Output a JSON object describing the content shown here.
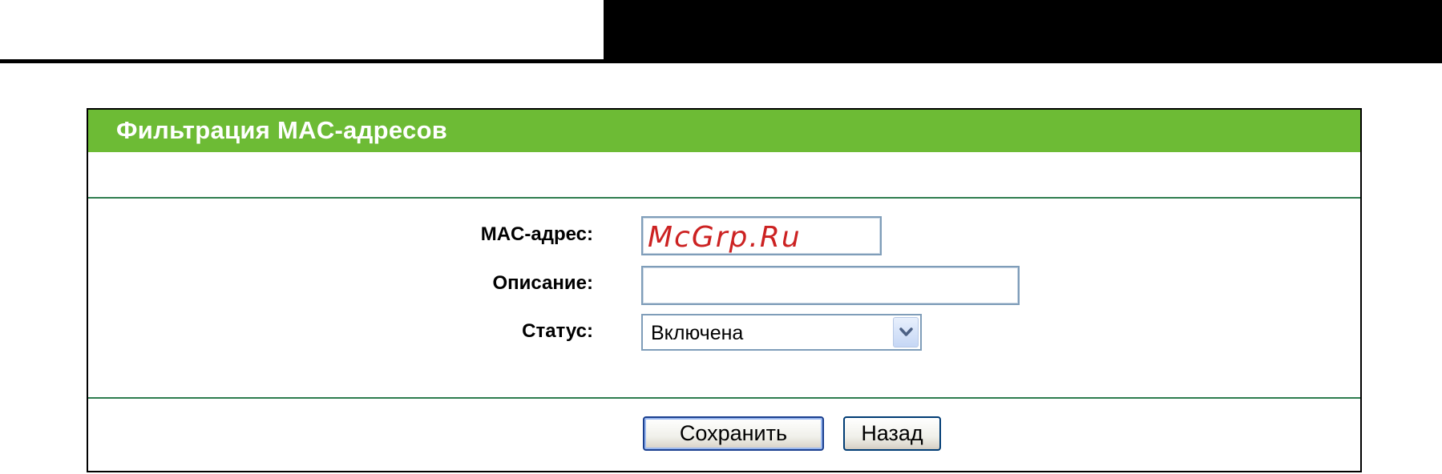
{
  "panel": {
    "title": "Фильтрация MAC-адресов"
  },
  "form": {
    "mac_label": "MAC-адрес:",
    "mac_value": "McGrp.Ru",
    "description_label": "Описание:",
    "description_value": "",
    "status_label": "Статус:",
    "status_value": "Включена"
  },
  "buttons": {
    "save_label": "Сохранить",
    "back_label": "Назад"
  },
  "colors": {
    "header_green": "#6dbb35",
    "divider_green": "#2e7d4f",
    "watermark_red": "#cc2222"
  },
  "icons": {
    "select_arrow": "chevron-down-icon"
  }
}
